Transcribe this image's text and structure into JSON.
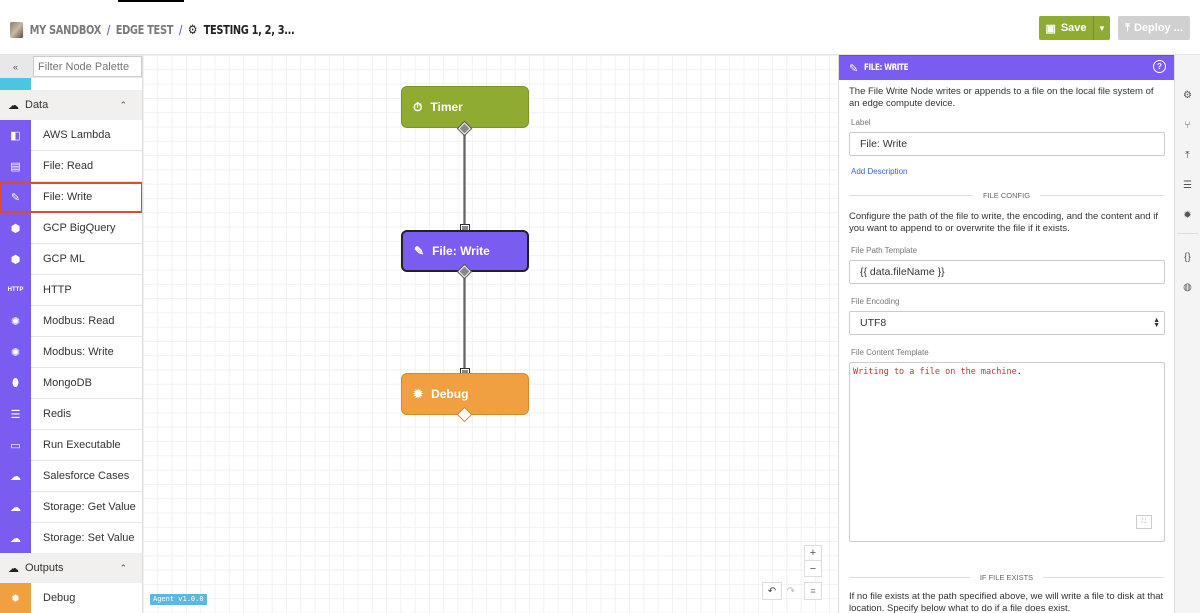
{
  "header": {
    "breadcrumbs": [
      "MY SANDBOX",
      "EDGE TEST"
    ],
    "separator": "/",
    "current": "TESTING 1, 2, 3...",
    "save_label": "Save",
    "deploy_label": "Deploy ..."
  },
  "palette": {
    "filter_placeholder": "Filter Node Palette",
    "collapse_icon": "«",
    "sections": [
      {
        "name": "Data",
        "items": [
          {
            "label": "AWS Lambda",
            "icon": "aws-lambda-icon"
          },
          {
            "label": "File: Read",
            "icon": "file-read-icon"
          },
          {
            "label": "File: Write",
            "icon": "file-write-icon",
            "selected": true
          },
          {
            "label": "GCP BigQuery",
            "icon": "gcp-bigquery-icon"
          },
          {
            "label": "GCP ML",
            "icon": "gcp-ml-icon"
          },
          {
            "label": "HTTP",
            "icon": "http-icon"
          },
          {
            "label": "Modbus: Read",
            "icon": "modbus-icon"
          },
          {
            "label": "Modbus: Write",
            "icon": "modbus-icon"
          },
          {
            "label": "MongoDB",
            "icon": "mongodb-icon"
          },
          {
            "label": "Redis",
            "icon": "redis-icon"
          },
          {
            "label": "Run Executable",
            "icon": "terminal-icon"
          },
          {
            "label": "Salesforce Cases",
            "icon": "salesforce-icon"
          },
          {
            "label": "Storage: Get Value",
            "icon": "cloud-storage-icon"
          },
          {
            "label": "Storage: Set Value",
            "icon": "cloud-storage-icon"
          }
        ]
      },
      {
        "name": "Outputs",
        "items": [
          {
            "label": "Debug",
            "icon": "bug-icon"
          }
        ]
      }
    ]
  },
  "canvas": {
    "nodes": [
      {
        "label": "Timer",
        "color": "#8fab32"
      },
      {
        "label": "File: Write",
        "color": "#7b5cf0"
      },
      {
        "label": "Debug",
        "color": "#f0a040"
      }
    ],
    "zoom_in": "+",
    "zoom_out": "−",
    "undo": "↶",
    "redo": "↷",
    "menu": "≡",
    "agent_version": "Agent v1.0.0"
  },
  "editor": {
    "title": "FILE: WRITE",
    "help": "?",
    "description": "The File Write Node writes or appends to a file on the local file system of an edge compute device.",
    "label_label": "Label",
    "label_value": "File: Write",
    "add_description": "Add Description",
    "file_config_heading": "FILE CONFIG",
    "file_config_desc": "Configure the path of the file to write, the encoding, and the content and if you want to append to or overwrite the file if it exists.",
    "path_label": "File Path Template",
    "path_value": "{{ data.fileName }}",
    "encoding_label": "File Encoding",
    "encoding_value": "UTF8",
    "content_label": "File Content Template",
    "content_value": "Writing to a file on the machine",
    "content_punct": ".",
    "if_exists_heading": "IF FILE EXISTS",
    "if_exists_desc": "If no file exists at the path specified above, we will write a file to disk at that location. Specify below what to do if a file does exist."
  },
  "colors": {
    "accent_purple": "#7b5cf0",
    "save_green": "#8fab32",
    "debug_orange": "#f0a040",
    "selection_red": "#e04a32"
  }
}
